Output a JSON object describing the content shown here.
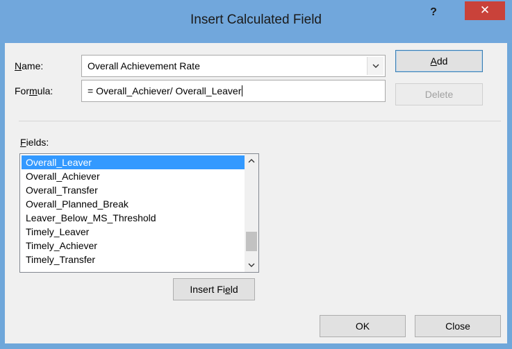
{
  "window": {
    "title": "Insert Calculated Field",
    "help_label": "?",
    "close_label": "✕"
  },
  "name": {
    "label_underlined": "N",
    "label_rest": "ame:",
    "value": "Overall Achievement Rate"
  },
  "formula": {
    "label_pre": "For",
    "label_underlined": "m",
    "label_rest": "ula:",
    "value": "= Overall_Achiever/ Overall_Leaver"
  },
  "buttons": {
    "add_underlined": "A",
    "add_rest": "dd",
    "delete_label": "Delete",
    "insert_field_pre": "Insert Fi",
    "insert_field_underlined": "e",
    "insert_field_rest": "ld",
    "ok_label": "OK",
    "close_label": "Close"
  },
  "fields": {
    "label_underlined": "F",
    "label_rest": "ields:",
    "items": [
      "Overall_Leaver",
      "Overall_Achiever",
      "Overall_Transfer",
      "Overall_Planned_Break",
      "Leaver_Below_MS_Threshold",
      "Timely_Leaver",
      "Timely_Achiever",
      "Timely_Transfer"
    ],
    "selected": "Overall_Leaver"
  },
  "icons": {
    "dropdown": "chevron-down-icon",
    "scroll_up": "chevron-up-icon",
    "scroll_down": "chevron-down-icon"
  },
  "colors": {
    "title_bar": "#71a7dc",
    "close_button": "#c9423a",
    "selection": "#3399ff"
  }
}
